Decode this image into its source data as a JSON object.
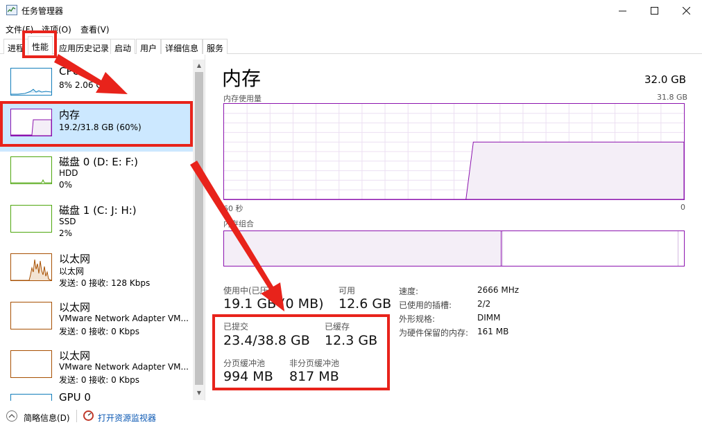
{
  "window": {
    "title": "任务管理器"
  },
  "menu": [
    "文件(F)",
    "选项(O)",
    "查看(V)"
  ],
  "tabs": [
    "进程",
    "性能",
    "应用历史记录",
    "启动",
    "用户",
    "详细信息",
    "服务"
  ],
  "sidebar": {
    "items": [
      {
        "title": "CPU",
        "sub1": "8% 2.06 GHz",
        "sub2": "",
        "sub3": ""
      },
      {
        "title": "内存",
        "sub1": "19.2/31.8 GB (60%)",
        "sub2": "",
        "sub3": ""
      },
      {
        "title": "磁盘 0 (D: E: F:)",
        "sub1": "HDD",
        "sub2": "0%",
        "sub3": ""
      },
      {
        "title": "磁盘 1 (C: J: H:)",
        "sub1": "SSD",
        "sub2": "2%",
        "sub3": ""
      },
      {
        "title": "以太网",
        "sub1": "以太网",
        "sub2": "发送: 0 接收: 128 Kbps",
        "sub3": ""
      },
      {
        "title": "以太网",
        "sub1": "VMware Network Adapter VM...",
        "sub2": "发送: 0 接收: 0 Kbps",
        "sub3": ""
      },
      {
        "title": "以太网",
        "sub1": "VMware Network Adapter VM...",
        "sub2": "发送: 0 接收: 0 Kbps",
        "sub3": ""
      },
      {
        "title": "GPU 0",
        "sub1": "",
        "sub2": "",
        "sub3": ""
      }
    ]
  },
  "memory": {
    "title": "内存",
    "total": "32.0 GB",
    "usage_label": "内存使用量",
    "usage_max": "31.8 GB",
    "time_left": "60 秒",
    "time_right": "0",
    "composition_label": "内存组合",
    "in_use_label": "使用中(已压缩)",
    "in_use_value": "19.1 GB (0 MB)",
    "available_label": "可用",
    "available_value": "12.6 GB",
    "committed_label": "已提交",
    "committed_value": "23.4/38.8 GB",
    "cached_label": "已缓存",
    "cached_value": "12.3 GB",
    "paged_label": "分页缓冲池",
    "paged_value": "994 MB",
    "nonpaged_label": "非分页缓冲池",
    "nonpaged_value": "817 MB",
    "details": [
      {
        "key": "速度:",
        "value": "2666 MHz"
      },
      {
        "key": "已使用的插槽:",
        "value": "2/2"
      },
      {
        "key": "外形规格:",
        "value": "DIMM"
      },
      {
        "key": "为硬件保留的内存:",
        "value": "161 MB"
      }
    ],
    "usage_fraction_recent": 0.6
  },
  "footer": {
    "brief": "简略信息(D)",
    "monitor": "打开资源监视器"
  },
  "colors": {
    "memory": "#8b12ae",
    "cpu": "#117dbb",
    "disk": "#4da60c",
    "network": "#a74f01",
    "highlight": "#e8231b",
    "selected": "#cce8ff"
  }
}
